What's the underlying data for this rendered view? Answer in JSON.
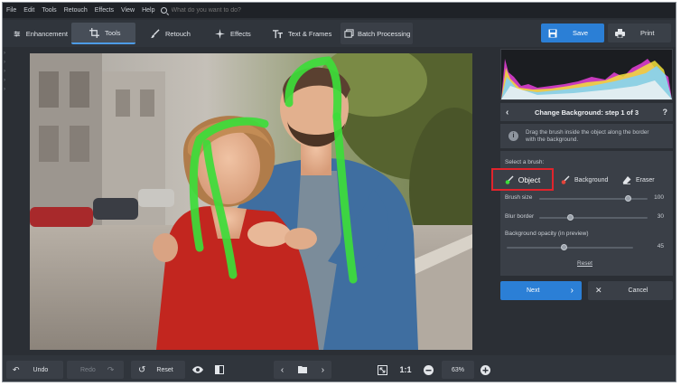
{
  "menu": [
    "File",
    "Edit",
    "Tools",
    "Retouch",
    "Effects",
    "View",
    "Help"
  ],
  "search": {
    "placeholder": "What do you want to do?"
  },
  "toolbar": {
    "tabs": [
      "Enhancement",
      "Tools",
      "Retouch",
      "Effects",
      "Text & Frames",
      "Batch Processing"
    ],
    "active_tab": "Tools",
    "save_label": "Save",
    "print_label": "Print"
  },
  "panel": {
    "title": "Change Background: step 1 of 3",
    "hint": "Drag the brush inside the object along the border with the background.",
    "select_brush_label": "Select a brush:",
    "brushes": [
      "Object",
      "Background",
      "Eraser"
    ],
    "selected_brush": "Object",
    "sliders": [
      {
        "label": "Brush size",
        "value": "100",
        "level": 1.0
      },
      {
        "label": "Blur border",
        "value": "30",
        "level": 0.3
      },
      {
        "label": "Background opacity (in preview)",
        "value": "45",
        "level": 0.45
      }
    ],
    "reset_label": "Reset",
    "next_label": "Next",
    "cancel_label": "Cancel"
  },
  "bottom": {
    "undo_label": "Undo",
    "redo_label": "Redo",
    "reset_label": "Reset",
    "actual_size_label": "1:1",
    "zoom": "63%"
  },
  "colors": {
    "accent": "#2b7fd6",
    "highlight": "#e0242c",
    "brush_stroke": "#3ddc3a"
  },
  "icons": [
    "search-icon",
    "sliders-icon",
    "crop-icon",
    "brush-icon",
    "sparkle-icon",
    "text-icon",
    "batch-icon",
    "save-icon",
    "print-icon",
    "info-icon",
    "object-brush-icon",
    "background-brush-icon",
    "eraser-icon",
    "undo-icon",
    "redo-icon",
    "reset-icon",
    "eye-icon",
    "compare-icon",
    "prev-icon",
    "folder-icon",
    "next-icon",
    "fit-icon",
    "zoom-out-icon",
    "zoom-in-icon"
  ]
}
